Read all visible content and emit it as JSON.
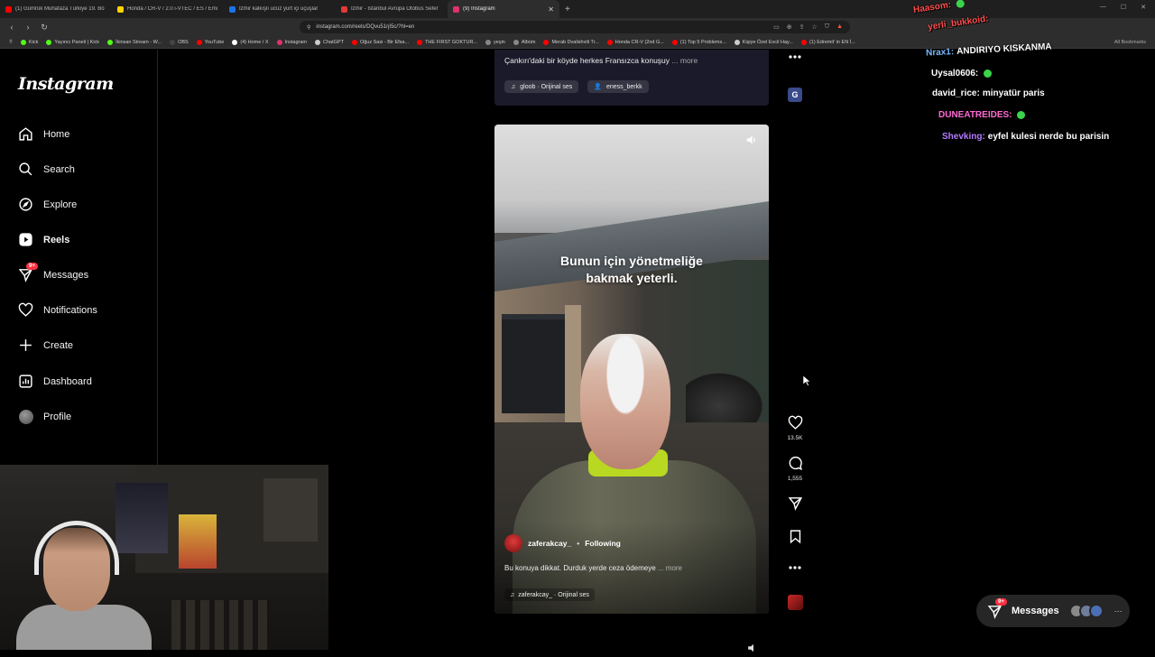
{
  "browser": {
    "tabs": [
      {
        "title": "(1) Gümrük Muhafaza Türkiye 19. Bö",
        "color": "#ff0000",
        "active": false
      },
      {
        "title": "Honda / CR-V / 2.0 i-VTEC / ES / Emi",
        "color": "#ffd400",
        "active": false
      },
      {
        "title": "İzmir kalkışlı ucuz yurt içi uçuşlar",
        "color": "#1a73e8",
        "active": false
      },
      {
        "title": "İzmir - İstanbul Avrupa Otobüs Sefer",
        "color": "#e53935",
        "active": false
      },
      {
        "title": "(9) Instagram",
        "color": "#e1306c",
        "active": true
      }
    ],
    "new_tab_icon": "plus-icon",
    "url": "instagram.com/reels/DQvu51rjI5c/?hl=en",
    "bookmarks": [
      {
        "label": "Kick",
        "color": "#53fc18"
      },
      {
        "label": "Yayıncı Paneli | Kick",
        "color": "#53fc18"
      },
      {
        "label": "İkinsan Stream - W...",
        "color": "#53fc18"
      },
      {
        "label": "OBS",
        "color": "#444444"
      },
      {
        "label": "YouTube",
        "color": "#ff0000"
      },
      {
        "label": "(4) Home / X",
        "color": "#ffffff"
      },
      {
        "label": "Instagram",
        "color": "#e1306c"
      },
      {
        "label": "ChatGPT",
        "color": "#cccccc"
      },
      {
        "label": "Oğuz Sasi - Bir Efsa...",
        "color": "#ff0000"
      },
      {
        "label": "THE FIRST GOKTUR...",
        "color": "#ff0000"
      },
      {
        "label": "yeşin",
        "color": "#888888"
      },
      {
        "label": "Albüm",
        "color": "#888888"
      },
      {
        "label": "Merab Dvalishvili Tr...",
        "color": "#ff0000"
      },
      {
        "label": "Honda CR-V (2nd G...",
        "color": "#ff0000"
      },
      {
        "label": "(1) Top 5 Problems...",
        "color": "#ff0000"
      },
      {
        "label": "Kişiye Özel Evcil Hay...",
        "color": "#cccccc"
      },
      {
        "label": "(1) Edremit' in EN İ...",
        "color": "#ff0000"
      }
    ],
    "all_bookmarks": "All Bookmarks"
  },
  "sidebar": {
    "logo": "Instagram",
    "items": [
      {
        "label": "Home",
        "icon": "home-icon",
        "name": "home"
      },
      {
        "label": "Search",
        "icon": "search-icon",
        "name": "search"
      },
      {
        "label": "Explore",
        "icon": "compass-icon",
        "name": "explore"
      },
      {
        "label": "Reels",
        "icon": "reels-icon",
        "name": "reels",
        "active": true
      },
      {
        "label": "Messages",
        "icon": "messenger-icon",
        "name": "messages",
        "badge": "9+"
      },
      {
        "label": "Notifications",
        "icon": "heart-icon",
        "name": "notifications"
      },
      {
        "label": "Create",
        "icon": "plus-icon",
        "name": "create"
      },
      {
        "label": "Dashboard",
        "icon": "dashboard-icon",
        "name": "dashboard"
      },
      {
        "label": "Profile",
        "icon": "avatar",
        "name": "profile"
      }
    ]
  },
  "previous_reel": {
    "caption": "Çankırı'daki bir köyde herkes Fransızca konuşuy",
    "more": "... more",
    "audio": "gloob · Orijinal ses",
    "tagged": "eness_berkk"
  },
  "reel": {
    "overlay_line1": "Bunun için yönetmeliğe",
    "overlay_line2": "bakmak yeterli.",
    "username": "zaferakcay_",
    "separator": "•",
    "follow_status": "Following",
    "caption": "Bu konuya dikkat. Durduk yerde ceza ödemeye",
    "more": "... more",
    "audio": "zaferakcay_ · Orijinal ses",
    "likes": "13.5K",
    "comments": "1,555"
  },
  "chat": {
    "lines": [
      {
        "user": "Haasom:",
        "message": "",
        "color": "#ff4d4d",
        "emote": true
      },
      {
        "user": "yerli_bukkoid:",
        "message": "",
        "color": "#ff4d4d",
        "emote": false
      },
      {
        "user": "Nrax1:",
        "message": "ANDIRIYO KISKANMA",
        "color": "#7ab8ff",
        "emote": false
      },
      {
        "user": "Uysal0606:",
        "message": "",
        "color": "#ffffff",
        "emote": true
      },
      {
        "user": "david_rice:",
        "message": "minyatür paris",
        "color": "#ffffff",
        "emote": false
      },
      {
        "user": "DUNEATREIDES:",
        "message": "",
        "color": "#ff6ad5",
        "emote": true
      },
      {
        "user": "Shevking:",
        "message": "eyfel kulesi nerde bu parisin",
        "color": "#b57bff",
        "emote": false
      }
    ]
  },
  "messages_pill": {
    "label": "Messages",
    "badge": "9+"
  }
}
